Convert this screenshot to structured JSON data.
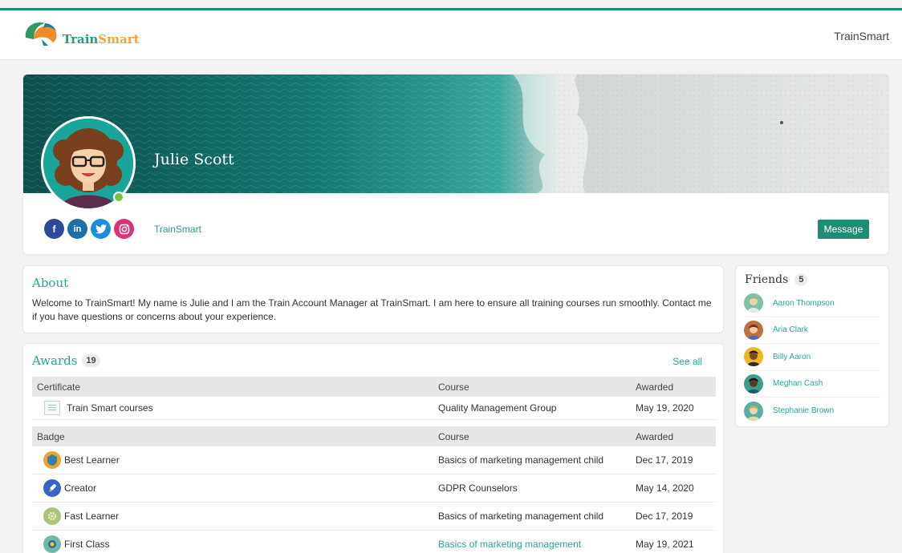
{
  "header": {
    "logo_text_primary": "Train",
    "logo_text_accent": "Smart",
    "right_label": "TrainSmart"
  },
  "profile": {
    "name": "Julie Scott",
    "link_label": "TrainSmart",
    "message_button": "Message",
    "socials": [
      {
        "name": "facebook",
        "glyph": "f"
      },
      {
        "name": "linkedin",
        "glyph": "in"
      },
      {
        "name": "twitter",
        "glyph": "t"
      },
      {
        "name": "instagram",
        "glyph": "◎"
      }
    ]
  },
  "about": {
    "title": "About",
    "text": "Welcome to TrainSmart! My name is Julie and I am the Train Account Manager at TrainSmart. I am here to ensure all training courses run smoothly. Contact me if you have questions or concerns about your experience."
  },
  "awards": {
    "title": "Awards",
    "count": "19",
    "see_all": "See all",
    "certificate_headers": [
      "Certificate",
      "Course",
      "Awarded"
    ],
    "certificates": [
      {
        "name": "Train Smart courses",
        "course": "Quality Management Group",
        "awarded": "May 19, 2020"
      }
    ],
    "badge_headers": [
      "Badge",
      "Course",
      "Awarded"
    ],
    "badges": [
      {
        "name": "Best Learner",
        "course": "Basics of marketing management child",
        "awarded": "Dec 17, 2019",
        "icon": "shield-badge-icon",
        "color": "#e8a531"
      },
      {
        "name": "Creator",
        "course": "GDPR Counselors",
        "awarded": "May 14, 2020",
        "icon": "rocket-badge-icon",
        "color": "#3a63c9"
      },
      {
        "name": "Fast Learner",
        "course": "Basics of marketing management child",
        "awarded": "Dec 17, 2019",
        "icon": "gear-badge-icon",
        "color": "#a9c57a"
      },
      {
        "name": "First Class",
        "course": "Basics of marketing management",
        "awarded": "May 19, 2021",
        "icon": "medal-badge-icon",
        "color": "#6fb7a8"
      }
    ]
  },
  "friends": {
    "title": "Friends",
    "count": "5",
    "items": [
      {
        "name": "Aaron Thompson",
        "color": "#7cc3a7"
      },
      {
        "name": "Aria Clark",
        "color": "#c0703f"
      },
      {
        "name": "Billy Aaron",
        "color": "#f0b620"
      },
      {
        "name": "Meghan Cash",
        "color": "#3aa08a"
      },
      {
        "name": "Stephanie Brown",
        "color": "#58b0a4"
      }
    ]
  },
  "colors": {
    "accent": "#1f8c74",
    "link": "#2ba29a"
  }
}
